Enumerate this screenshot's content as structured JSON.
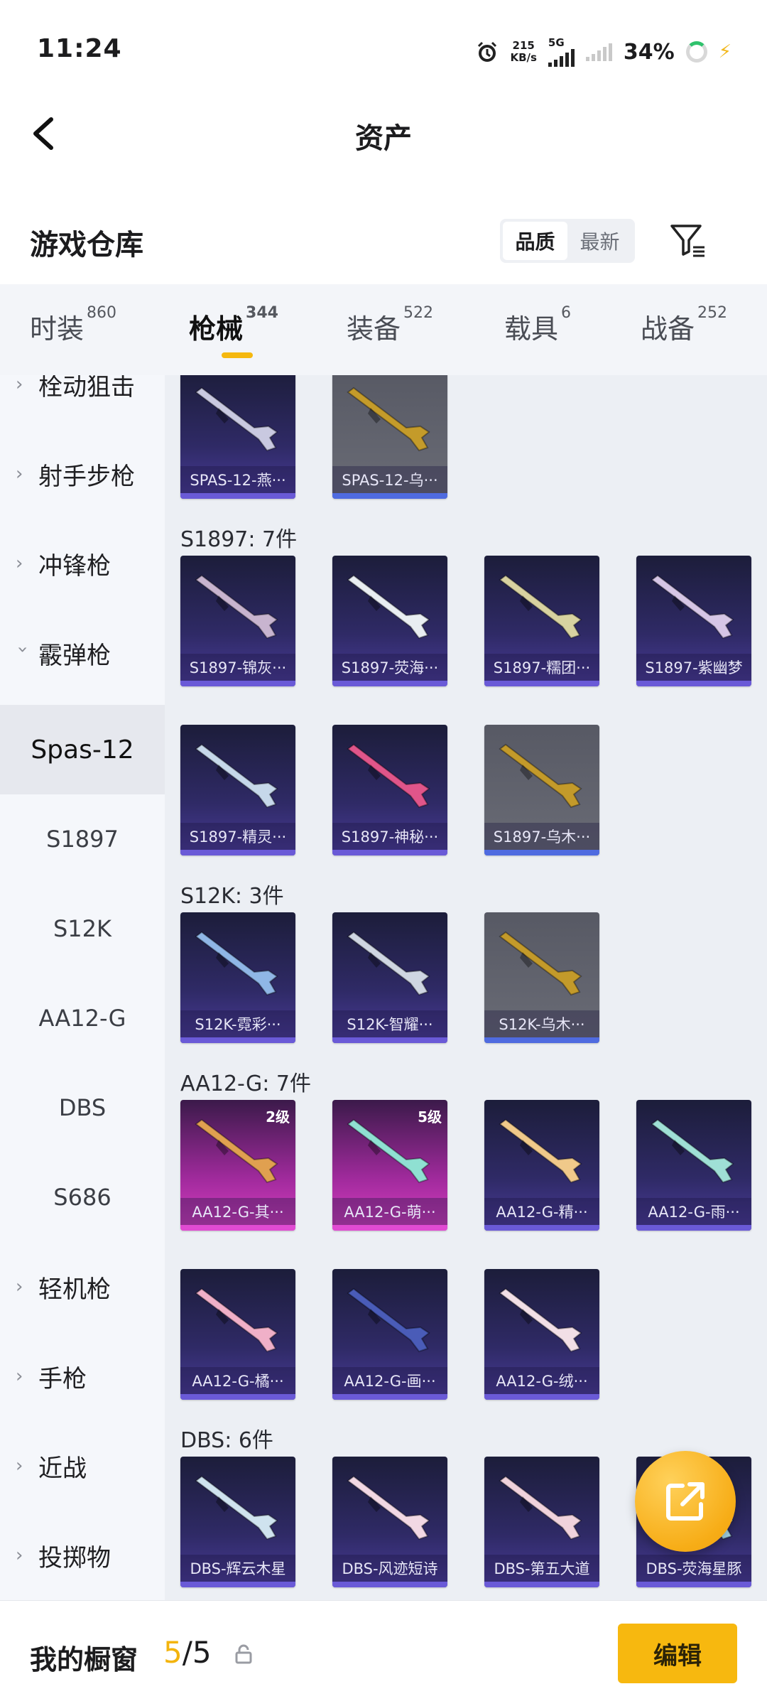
{
  "status_bar": {
    "time": "11:24",
    "net_speed_value": "215",
    "net_speed_unit": "KB/s",
    "network": "5G",
    "battery": "34%",
    "icons": [
      "alarm-icon",
      "signal-icon",
      "battery-icon",
      "charging-icon"
    ]
  },
  "header": {
    "title": "资产",
    "back_icon": "chevron-left-icon"
  },
  "warehouse": {
    "title": "游戏仓库",
    "sort_options": [
      "品质",
      "最新"
    ],
    "sort_selected": "品质",
    "filter_icon": "filter-icon"
  },
  "tabs": [
    {
      "label": "时装",
      "count": "860"
    },
    {
      "label": "枪械",
      "count": "344",
      "active": true
    },
    {
      "label": "装备",
      "count": "522"
    },
    {
      "label": "载具",
      "count": "6"
    },
    {
      "label": "战备",
      "count": "252"
    }
  ],
  "sidebar": [
    {
      "label": "栓动狙击",
      "type": "group"
    },
    {
      "label": "射手步枪",
      "type": "group"
    },
    {
      "label": "冲锋枪",
      "type": "group"
    },
    {
      "label": "霰弹枪",
      "type": "group",
      "expanded": true
    },
    {
      "label": "Spas-12",
      "type": "sub",
      "active": true
    },
    {
      "label": "S1897",
      "type": "sub"
    },
    {
      "label": "S12K",
      "type": "sub"
    },
    {
      "label": "AA12-G",
      "type": "sub"
    },
    {
      "label": "DBS",
      "type": "sub"
    },
    {
      "label": "S686",
      "type": "sub"
    },
    {
      "label": "轻机枪",
      "type": "group"
    },
    {
      "label": "手枪",
      "type": "group"
    },
    {
      "label": "近战",
      "type": "group"
    },
    {
      "label": "投掷物",
      "type": "group"
    }
  ],
  "sections": [
    {
      "label": "",
      "items": [
        {
          "name": "SPAS-12-燕···",
          "rarity": "epic",
          "gun_color": "#c9c9e0"
        },
        {
          "name": "SPAS-12-乌···",
          "rarity": "common",
          "gun_color": "#c49b2a"
        }
      ]
    },
    {
      "label": "S1897: 7件",
      "items": [
        {
          "name": "S1897-锦灰···",
          "rarity": "epic",
          "gun_color": "#c8b4cf"
        },
        {
          "name": "S1897-荧海···",
          "rarity": "epic",
          "gun_color": "#e9eef2"
        },
        {
          "name": "S1897-糯团···",
          "rarity": "epic",
          "gun_color": "#d8d2a0"
        },
        {
          "name": "S1897-紫幽梦",
          "rarity": "epic",
          "gun_color": "#d6c6e6"
        },
        {
          "name": "S1897-精灵···",
          "rarity": "epic",
          "gun_color": "#c6d8ea"
        },
        {
          "name": "S1897-神秘···",
          "rarity": "epic",
          "gun_color": "#e0558a"
        },
        {
          "name": "S1897-乌木···",
          "rarity": "common",
          "gun_color": "#c39a2a"
        }
      ]
    },
    {
      "label": "S12K: 3件",
      "items": [
        {
          "name": "S12K-霓彩···",
          "rarity": "epic",
          "gun_color": "#8fb6e6"
        },
        {
          "name": "S12K-智耀···",
          "rarity": "epic",
          "gun_color": "#cfd6e2"
        },
        {
          "name": "S12K-乌木···",
          "rarity": "common",
          "gun_color": "#c39a2a"
        }
      ]
    },
    {
      "label": "AA12-G: 7件",
      "items": [
        {
          "name": "AA12-G-其···",
          "rarity": "legendary",
          "level": "2级",
          "gun_color": "#e0a050"
        },
        {
          "name": "AA12-G-萌···",
          "rarity": "legendary",
          "level": "5级",
          "gun_color": "#8fe0d2"
        },
        {
          "name": "AA12-G-精···",
          "rarity": "epic",
          "gun_color": "#f0c98a"
        },
        {
          "name": "AA12-G-雨···",
          "rarity": "epic",
          "gun_color": "#9fe0d6"
        },
        {
          "name": "AA12-G-橘···",
          "rarity": "epic",
          "gun_color": "#f0b0c8"
        },
        {
          "name": "AA12-G-画···",
          "rarity": "epic",
          "gun_color": "#4a5cb8"
        },
        {
          "name": "AA12-G-绒···",
          "rarity": "epic",
          "gun_color": "#f2dfe6"
        }
      ]
    },
    {
      "label": "DBS: 6件",
      "items": [
        {
          "name": "DBS-辉云木星",
          "rarity": "epic",
          "gun_color": "#cfe3ef"
        },
        {
          "name": "DBS-风迹短诗",
          "rarity": "epic",
          "gun_color": "#f2d8e4"
        },
        {
          "name": "DBS-第五大道",
          "rarity": "epic",
          "gun_color": "#f0d2dc"
        },
        {
          "name": "DBS-荧海星豚",
          "rarity": "epic",
          "gun_color": "#a6d6ea"
        }
      ]
    }
  ],
  "fab_icon": "share-icon",
  "bottom_bar": {
    "label": "我的橱窗",
    "current": "5",
    "total": "/5",
    "lock_icon": "lock-icon",
    "edit_label": "编辑"
  },
  "colors": {
    "accent": "#f5b80f",
    "epic": "#2f2a66",
    "legendary": "#a02a9c",
    "common": "#6a6c76"
  }
}
